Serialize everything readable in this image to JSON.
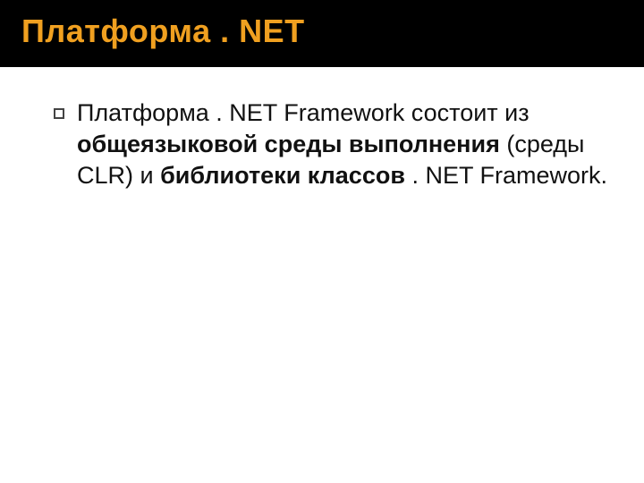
{
  "title": "Платформа . NET",
  "bullet": {
    "seg1": "Платформа . NET Framework состоит из ",
    "bold1": "общеязыковой среды выполнения",
    "seg2": " (среды CLR) и ",
    "bold2": "библиотеки классов",
    "seg3": " . NET Framework."
  },
  "colors": {
    "title_bg": "#000000",
    "title_fg": "#f0a020",
    "body_fg": "#111111"
  }
}
